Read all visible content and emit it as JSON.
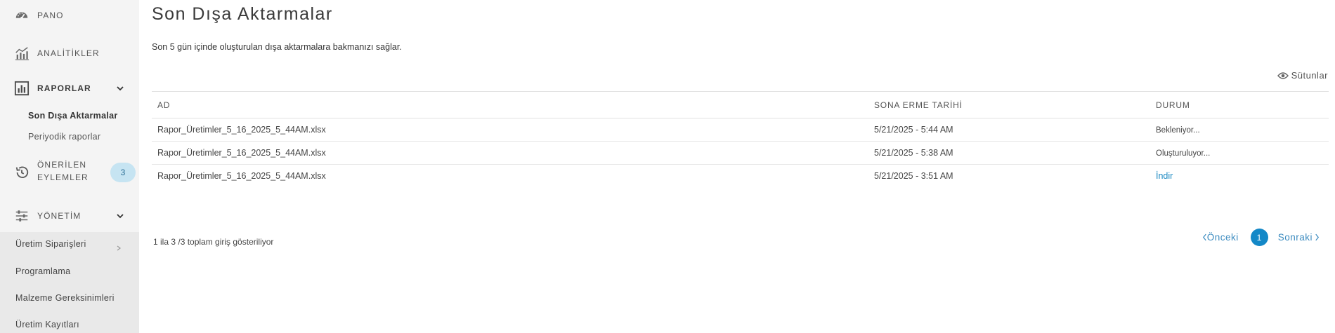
{
  "sidebar": {
    "items": [
      {
        "label": "PANO",
        "icon": "dashboard-gauge-icon"
      },
      {
        "label": "ANALİTİKLER",
        "icon": "analytics-chart-icon"
      },
      {
        "label": "RAPORLAR",
        "icon": "reports-bar-chart-icon"
      },
      {
        "label": "ÖNERİLEN",
        "label2": "EYLEMLER",
        "icon": "history-clock-icon",
        "badge": "3"
      },
      {
        "label": "YÖNETİM",
        "icon": "sliders-icon"
      }
    ],
    "reports_sub": [
      {
        "label": "Son Dışa Aktarmalar",
        "active": true
      },
      {
        "label": "Periyodik raporlar",
        "active": false
      }
    ],
    "management_sub": [
      {
        "label": "Üretim Siparişleri"
      },
      {
        "label": "Programlama"
      },
      {
        "label": "Malzeme Gereksinimleri"
      },
      {
        "label": "Üretim Kayıtları"
      }
    ]
  },
  "main": {
    "title": "Son Dışa Aktarmalar",
    "description": "Son 5 gün içinde oluşturulan dışa aktarmalara bakmanızı sağlar.",
    "columns_button": "Sütunlar",
    "table": {
      "headers": [
        "AD",
        "SONA ERME TARİHİ",
        "DURUM"
      ],
      "rows": [
        {
          "name": "Rapor_Üretimler_5_16_2025_5_44AM.xlsx",
          "expiry": "5/21/2025 - 5:44 AM",
          "status": "Bekleniyor..."
        },
        {
          "name": "Rapor_Üretimler_5_16_2025_5_44AM.xlsx",
          "expiry": "5/21/2025 - 5:38 AM",
          "status": "Oluşturuluyor..."
        },
        {
          "name": "Rapor_Üretimler_5_16_2025_5_44AM.xlsx",
          "expiry": "5/21/2025 - 3:51 AM",
          "status": "İndir"
        }
      ]
    },
    "entries_info": "1 ila 3 /3 toplam giriş gösteriliyor",
    "pagination": {
      "prev": "Önceki",
      "current": "1",
      "next": "Sonraki"
    }
  },
  "colors": {
    "accent": "#1488c7",
    "badge_bg": "#c6e4f2",
    "sidebar_bg": "#f4f4f4",
    "sidebar_lower_bg": "#e9e9e9"
  }
}
